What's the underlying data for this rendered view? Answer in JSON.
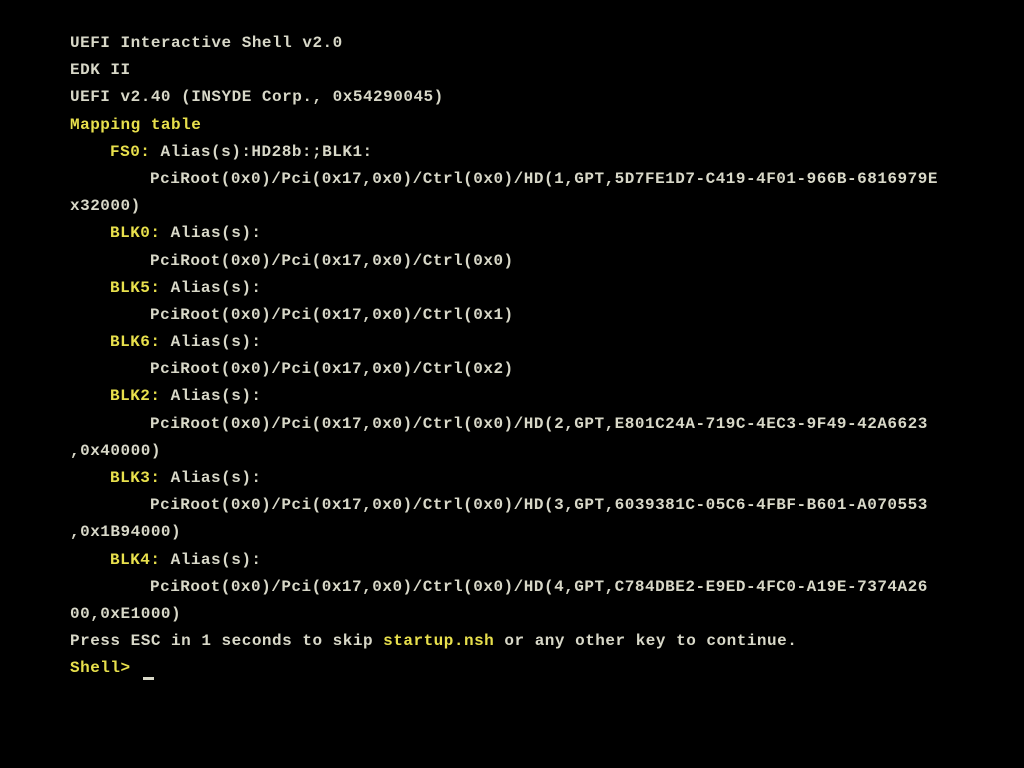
{
  "header": {
    "line1": "UEFI Interactive Shell v2.0",
    "line2": "EDK II",
    "line3": "UEFI v2.40 (INSYDE Corp., 0x54290045)"
  },
  "mapping": {
    "title": "Mapping table",
    "fs0": {
      "label": "FS0:",
      "alias": " Alias(s):HD28b:;BLK1:",
      "path": "PciRoot(0x0)/Pci(0x17,0x0)/Ctrl(0x0)/HD(1,GPT,5D7FE1D7-C419-4F01-966B-6816979E",
      "wrap": "x32000)"
    },
    "blk0": {
      "label": "BLK0:",
      "alias": " Alias(s):",
      "path": "PciRoot(0x0)/Pci(0x17,0x0)/Ctrl(0x0)"
    },
    "blk5": {
      "label": "BLK5:",
      "alias": " Alias(s):",
      "path": "PciRoot(0x0)/Pci(0x17,0x0)/Ctrl(0x1)"
    },
    "blk6": {
      "label": "BLK6:",
      "alias": " Alias(s):",
      "path": "PciRoot(0x0)/Pci(0x17,0x0)/Ctrl(0x2)"
    },
    "blk2": {
      "label": "BLK2:",
      "alias": " Alias(s):",
      "path": "PciRoot(0x0)/Pci(0x17,0x0)/Ctrl(0x0)/HD(2,GPT,E801C24A-719C-4EC3-9F49-42A6623",
      "wrap": ",0x40000)"
    },
    "blk3": {
      "label": "BLK3:",
      "alias": " Alias(s):",
      "path": "PciRoot(0x0)/Pci(0x17,0x0)/Ctrl(0x0)/HD(3,GPT,6039381C-05C6-4FBF-B601-A070553",
      "wrap": ",0x1B94000)"
    },
    "blk4": {
      "label": "BLK4:",
      "alias": " Alias(s):",
      "path": "PciRoot(0x0)/Pci(0x17,0x0)/Ctrl(0x0)/HD(4,GPT,C784DBE2-E9ED-4FC0-A19E-7374A26",
      "wrap": "00,0xE1000)"
    }
  },
  "footer": {
    "press_pre": "Press ESC in 1 seconds to skip ",
    "startup": "startup.nsh",
    "press_post": " or any other key to continue.",
    "prompt": "Shell> "
  }
}
